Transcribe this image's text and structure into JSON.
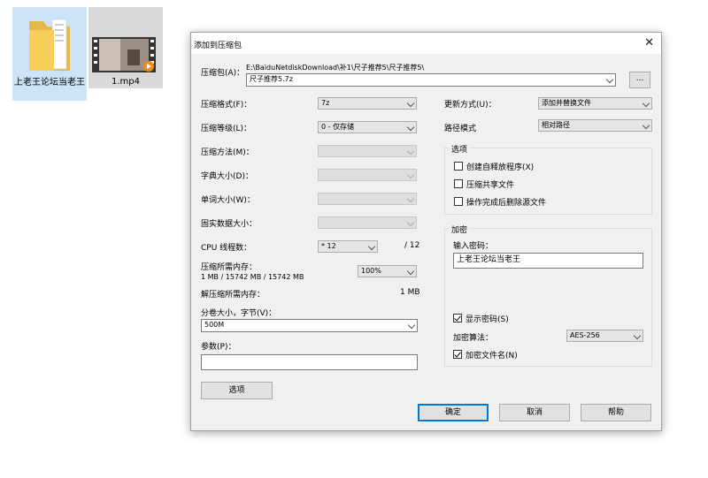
{
  "desktop": {
    "folder_label": "上老王论坛当老王",
    "video_label": "1.mp4"
  },
  "dialog": {
    "title": "添加到压缩包",
    "archive_label": "压缩包(A)：",
    "archive_path": "E:\\BaiduNetdiskDownload\\补1\\尺子推荐5\\尺子推荐5\\",
    "archive_name": "尺子推荐5.7z",
    "browse_label": "...",
    "left": {
      "format_label": "压缩格式(F)：",
      "format_value": "7z",
      "level_label": "压缩等级(L)：",
      "level_value": "0 - 仅存储",
      "method_label": "压缩方法(M)：",
      "dict_label": "字典大小(D)：",
      "word_label": "单词大小(W)：",
      "solid_label": "固实数据大小：",
      "cpu_label": "CPU 线程数：",
      "cpu_value": "* 12",
      "cpu_max": "/ 12",
      "mem_label": "压缩所需内存：",
      "mem_detail": "1 MB / 15742 MB / 15742 MB",
      "mem_percent": "100%",
      "decomp_label": "解压缩所需内存：",
      "decomp_value": "1 MB",
      "volume_label": "分卷大小，字节(V)：",
      "volume_value": "500M",
      "params_label": "参数(P)：",
      "params_value": "",
      "options_button": "选项"
    },
    "right": {
      "update_label": "更新方式(U)：",
      "update_value": "添加并替换文件",
      "path_label": "路径模式",
      "path_value": "相对路径",
      "options_group": "选项",
      "opt_sfx": "创建自释放程序(X)",
      "opt_shared": "压缩共享文件",
      "opt_delete": "操作完成后删除源文件",
      "encrypt_group": "加密",
      "password_label": "输入密码：",
      "password_value": "上老王论坛当老王",
      "show_password": "显示密码(S)",
      "enc_method_label": "加密算法：",
      "enc_method_value": "AES-256",
      "encrypt_names": "加密文件名(N)"
    },
    "buttons": {
      "ok": "确定",
      "cancel": "取消",
      "help": "帮助"
    }
  }
}
